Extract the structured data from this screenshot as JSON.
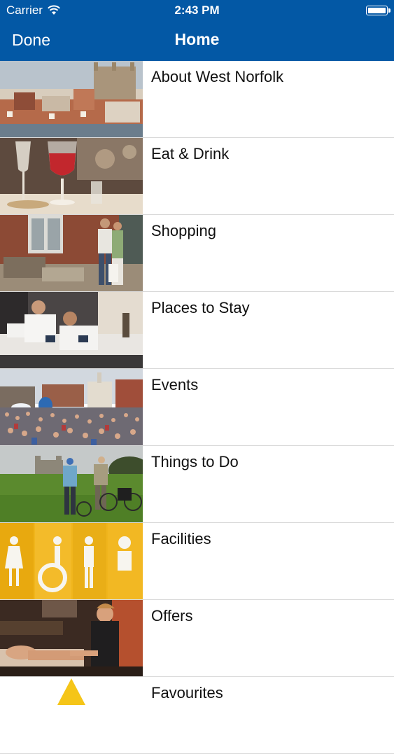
{
  "status_bar": {
    "carrier": "Carrier",
    "time": "2:43 PM"
  },
  "nav": {
    "left_button": "Done",
    "title": "Home"
  },
  "menu": [
    {
      "label": "About West Norfolk",
      "image": "town-skyline-photo"
    },
    {
      "label": "Eat & Drink",
      "image": "wine-glasses-photo"
    },
    {
      "label": "Shopping",
      "image": "shopping-street-photo"
    },
    {
      "label": "Places to Stay",
      "image": "hotel-bedroom-photo"
    },
    {
      "label": "Events",
      "image": "festival-crowd-photo"
    },
    {
      "label": "Things to Do",
      "image": "cyclists-castle-photo"
    },
    {
      "label": "Facilities",
      "image": "toilet-signs-photo"
    },
    {
      "label": "Offers",
      "image": "spa-massage-photo"
    },
    {
      "label": "Favourites",
      "image": "star-icon-photo"
    }
  ]
}
